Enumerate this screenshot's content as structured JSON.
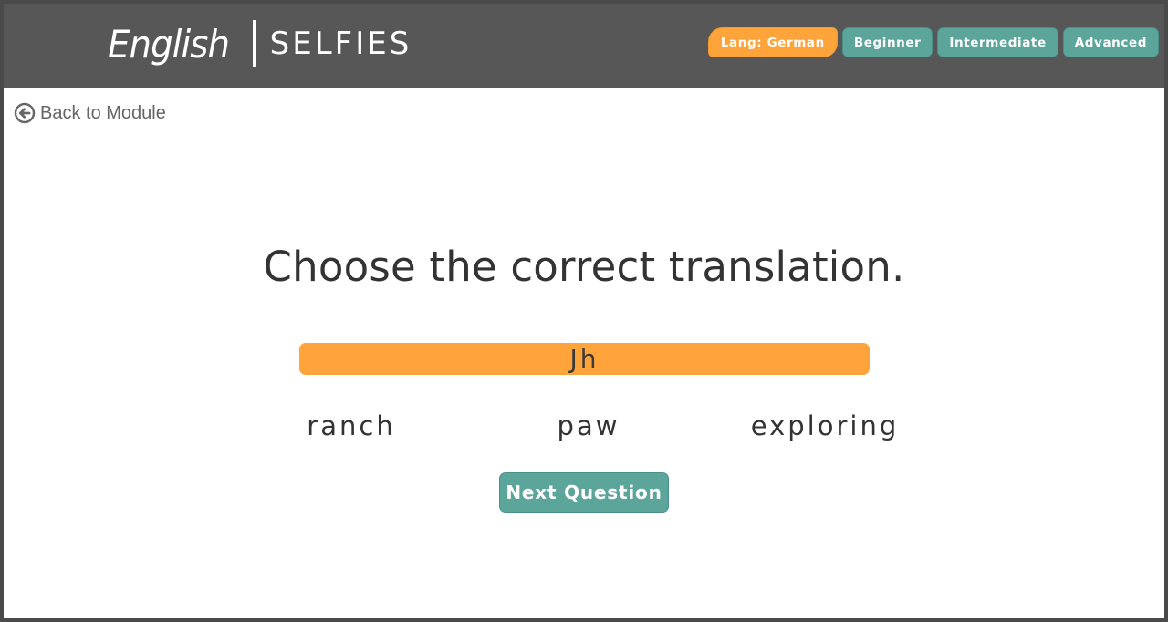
{
  "header": {
    "logo_primary": "English",
    "logo_secondary": "SELFIES",
    "nav": {
      "language_label": "Lang: German",
      "beginner_label": "Beginner",
      "intermediate_label": "Intermediate",
      "advanced_label": "Advanced"
    }
  },
  "back_link": {
    "label": "Back to Module",
    "icon": "arrow-left-circle-icon"
  },
  "quiz": {
    "instruction": "Choose the correct translation.",
    "prompt_word": "Jh",
    "choices": [
      "ranch",
      "paw",
      "exploring"
    ],
    "next_label": "Next Question"
  },
  "colors": {
    "header_bg": "#575757",
    "accent_orange": "#ffa43a",
    "accent_teal": "#5ba59b",
    "text_dark": "#333333",
    "link_gray": "#666666"
  }
}
